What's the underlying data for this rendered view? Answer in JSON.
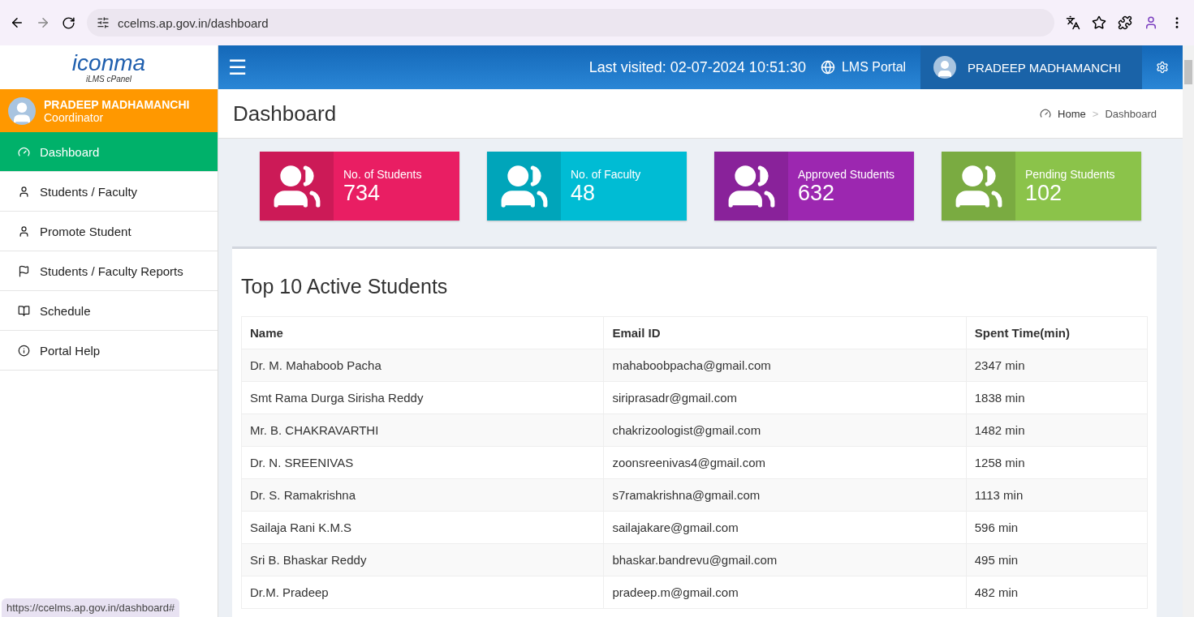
{
  "browser": {
    "url": "ccelms.ap.gov.in/dashboard",
    "status_url": "https://ccelms.ap.gov.in/dashboard#"
  },
  "logo": {
    "brand": "iconma",
    "subtitle": "iLMS cPanel"
  },
  "profile": {
    "name": "PRADEEP MADHAMANCHI",
    "role": "Coordinator"
  },
  "sidebar": {
    "items": [
      {
        "label": "Dashboard",
        "selected": true
      },
      {
        "label": "Students / Faculty",
        "selected": false
      },
      {
        "label": "Promote Student",
        "selected": false
      },
      {
        "label": "Students / Faculty Reports",
        "selected": false
      },
      {
        "label": "Schedule",
        "selected": false
      },
      {
        "label": "Portal Help",
        "selected": false
      }
    ]
  },
  "header": {
    "menu_glyph": "☰",
    "last_visited": "Last visited: 02-07-2024 10:51:30",
    "portal": "LMS Portal",
    "user": "PRADEEP MADHAMANCHI"
  },
  "page": {
    "title": "Dashboard",
    "breadcrumb": [
      "Home",
      "Dashboard"
    ],
    "separator": ">"
  },
  "stats": [
    {
      "label": "No. of Students",
      "value": "734",
      "color": "#e91e63"
    },
    {
      "label": "No. of Faculty",
      "value": "48",
      "color": "#00bcd4"
    },
    {
      "label": "Approved Students",
      "value": "632",
      "color": "#9c27b0"
    },
    {
      "label": "Pending Students",
      "value": "102",
      "color": "#8bc34a"
    }
  ],
  "table": {
    "title": "Top 10 Active Students",
    "columns": [
      "Name",
      "Email ID",
      "Spent Time(min)"
    ],
    "rows": [
      [
        "Dr. M. Mahaboob Pacha",
        "mahaboobpacha@gmail.com",
        "2347 min"
      ],
      [
        "Smt Rama Durga Sirisha Reddy",
        "siriprasadr@gmail.com",
        "1838 min"
      ],
      [
        "Mr. B. CHAKRAVARTHI",
        "chakrizoologist@gmail.com",
        "1482 min"
      ],
      [
        "Dr. N. SREENIVAS",
        "zoonsreenivas4@gmail.com",
        "1258 min"
      ],
      [
        "Dr. S. Ramakrishna",
        "s7ramakrishna@gmail.com",
        "1113 min"
      ],
      [
        "Sailaja Rani K.M.S",
        "sailajakare@gmail.com",
        "596 min"
      ],
      [
        "Sri B. Bhaskar Reddy",
        "bhaskar.bandrevu@gmail.com",
        "495 min"
      ],
      [
        "Dr.M. Pradeep",
        "pradeep.m@gmail.com",
        "482 min"
      ]
    ]
  }
}
